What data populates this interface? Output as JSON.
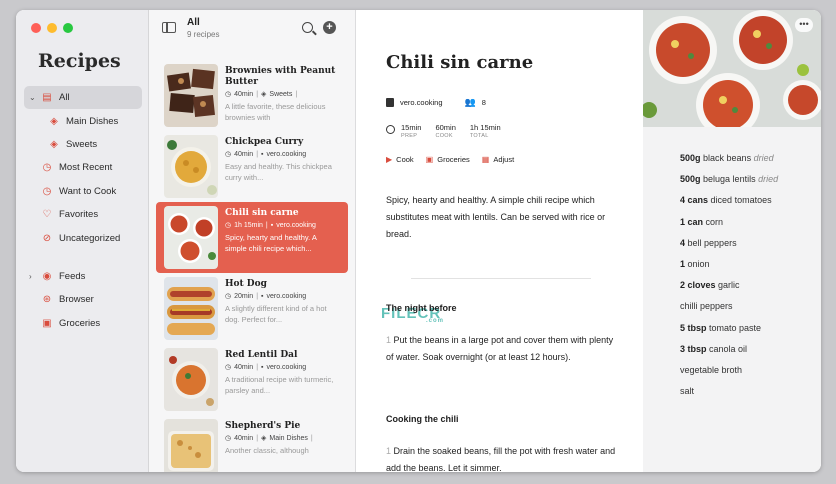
{
  "sidebar": {
    "title": "Recipes",
    "items": [
      {
        "label": "All",
        "icon": "tray-icon",
        "active": true,
        "chevron": "⌄"
      },
      {
        "label": "Main Dishes",
        "icon": "tag-icon",
        "sub": true
      },
      {
        "label": "Sweets",
        "icon": "tag-icon",
        "sub": true
      },
      {
        "label": "Most Recent",
        "icon": "clock-icon"
      },
      {
        "label": "Want to Cook",
        "icon": "clock-icon"
      },
      {
        "label": "Favorites",
        "icon": "heart-icon"
      },
      {
        "label": "Uncategorized",
        "icon": "untagged-icon"
      }
    ],
    "items2": [
      {
        "label": "Feeds",
        "icon": "feed-icon",
        "chevron": "›"
      },
      {
        "label": "Browser",
        "icon": "compass-icon"
      },
      {
        "label": "Groceries",
        "icon": "bag-icon"
      }
    ]
  },
  "list": {
    "title": "All",
    "count": "9 recipes",
    "recipes": [
      {
        "name": "Brownies with Peanut Butter",
        "time": "40min",
        "tag": "Sweets",
        "desc": "A little favorite, these delicious brownies with",
        "selected": false
      },
      {
        "name": "Chickpea Curry",
        "time": "40min",
        "tag": "vero.cooking",
        "desc": "Easy and healthy. This chickpea curry with...",
        "selected": false
      },
      {
        "name": "Chili sin carne",
        "time": "1h 15min",
        "tag": "vero.cooking",
        "desc": "Spicy, hearty and healthy. A simple chili recipe which...",
        "selected": true
      },
      {
        "name": "Hot Dog",
        "time": "20min",
        "tag": "vero.cooking",
        "desc": "A slightly different kind of a hot dog. Perfect for...",
        "selected": false
      },
      {
        "name": "Red Lentil Dal",
        "time": "40min",
        "tag": "vero.cooking",
        "desc": "A traditional recipe with turmeric, parsley and...",
        "selected": false
      },
      {
        "name": "Shepherd's Pie",
        "time": "40min",
        "tag": "Main Dishes",
        "desc": "Another classic, although",
        "selected": false
      }
    ]
  },
  "detail": {
    "title": "Chili sin carne",
    "source": "vero.cooking",
    "servings": "8",
    "prep": "15min",
    "prep_label": "PREP",
    "cook": "60min",
    "cook_label": "COOK",
    "total": "1h 15min",
    "total_label": "TOTAL",
    "actions": {
      "cook": "Cook",
      "groceries": "Groceries",
      "adjust": "Adjust"
    },
    "description": "Spicy, hearty and healthy. A simple chili recipe which substitutes meat with lentils. Can be served with rice or bread.",
    "section1": "The night before",
    "step1_num": "1",
    "step1": "Put the beans in a large pot and cover them with plenty of water. Soak overnight (or at least 12 hours).",
    "section2": "Cooking the chili",
    "step2_num": "1",
    "step2": "Drain the soaked beans, fill the pot with fresh water and add the beans. Let it simmer.",
    "watermark": "FILECR",
    "watermark_sub": ".com"
  },
  "ingredients": [
    {
      "qty": "500g",
      "name": "black beans",
      "note": "dried"
    },
    {
      "qty": "500g",
      "name": "beluga lentils",
      "note": "dried"
    },
    {
      "qty": "4 cans",
      "name": "diced tomatoes",
      "note": ""
    },
    {
      "qty": "1 can",
      "name": "corn",
      "note": ""
    },
    {
      "qty": "4",
      "name": "bell peppers",
      "note": ""
    },
    {
      "qty": "1",
      "name": "onion",
      "note": ""
    },
    {
      "qty": "2 cloves",
      "name": "garlic",
      "note": ""
    },
    {
      "qty": "",
      "name": "chilli peppers",
      "note": ""
    },
    {
      "qty": "5 tbsp",
      "name": "tomato paste",
      "note": ""
    },
    {
      "qty": "3 tbsp",
      "name": "canola oil",
      "note": ""
    },
    {
      "qty": "",
      "name": "vegetable broth",
      "note": ""
    },
    {
      "qty": "",
      "name": "salt",
      "note": ""
    }
  ],
  "colors": {
    "accent": "#e4604f",
    "icon_red": "#d94c3d"
  }
}
